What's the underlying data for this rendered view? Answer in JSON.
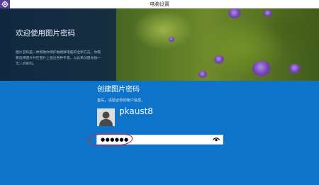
{
  "window": {
    "title": "电脑设置",
    "icon": "settings-gear-icon"
  },
  "info_panel": {
    "title": "欢迎使用图片密码",
    "description": "图片密码是一种帮助你保护触摸屏电脑的全新方法。你需要选择图片并在图片上画出各种手势，以此来创建你独一无二的密码。"
  },
  "verify": {
    "heading": "创建图片密码",
    "subheading": "首先，请验证你的帐户信息。",
    "username": "pkaust8",
    "password_value": "●●●●●●",
    "reveal_icon": "eye-icon"
  },
  "colors": {
    "background_blue": "#0e74c9",
    "annotation_red": "#d8252b"
  }
}
